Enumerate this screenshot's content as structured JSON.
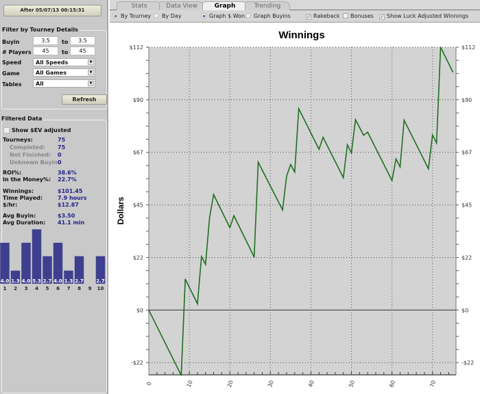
{
  "left": {
    "date_button": "After 05/07/13 00:15:31",
    "filter_title": "Filter by Tourney Details",
    "buyin_label": "Buyin",
    "buyin_from": "3.5",
    "buyin_to": "3.5",
    "players_label": "# Players",
    "players_from": "45",
    "players_to": "45",
    "to_label": "to",
    "speed_label": "Speed",
    "speed_value": "All Speeds",
    "game_label": "Game",
    "game_value": "All Games",
    "tables_label": "Tables",
    "tables_value": "All",
    "refresh": "Refresh",
    "filtered_title": "Filtered Data",
    "ev_label": "Show $EV adjusted",
    "stats": [
      {
        "label": "Tourneys:",
        "value": "75",
        "sub": false
      },
      {
        "label": "Completed:",
        "value": "75",
        "sub": true
      },
      {
        "label": "Not Finished:",
        "value": "0",
        "sub": true
      },
      {
        "label": "Unknown Buyin:",
        "value": "0",
        "sub": true
      },
      {
        "label": "ROI%:",
        "value": "38.6%",
        "sub": false
      },
      {
        "label": "In the Money%:",
        "value": "22.7%",
        "sub": false
      },
      {
        "label": "Winnings:",
        "value": "$101.45",
        "sub": false
      },
      {
        "label": "Time Played:",
        "value": "7.9 hours",
        "sub": false
      },
      {
        "label": "$/hr:",
        "value": "$12.87",
        "sub": false
      },
      {
        "label": "Avg Buyin:",
        "value": "$3.50",
        "sub": false
      },
      {
        "label": "Avg Duration:",
        "value": "41.1 min",
        "sub": false
      }
    ],
    "histogram": {
      "categories": [
        "1",
        "2",
        "3",
        "4",
        "5",
        "6",
        "7",
        "8",
        "9",
        "10"
      ],
      "values": [
        4.0,
        1.3,
        4.0,
        5.3,
        2.7,
        4.0,
        1.3,
        2.7,
        null,
        2.7
      ],
      "labels": [
        "4.0",
        "1.3",
        "4.0",
        "5.3",
        "2.7",
        "4.0",
        "1.3",
        "2.7",
        "",
        "2.7"
      ],
      "color": "#3f3f8f"
    }
  },
  "tabs": [
    {
      "label": "Stats",
      "active": false
    },
    {
      "label": "Data View",
      "active": false
    },
    {
      "label": "Graph",
      "active": true
    },
    {
      "label": "Trending",
      "active": false
    }
  ],
  "options": {
    "by_tourney": "By Tourney",
    "by_day": "By Day",
    "graph_won": "Graph $ Won",
    "graph_buyins": "Graph Buyins",
    "rakeback": "Rakeback",
    "bonuses": "Bonuses",
    "luck": "Show Luck Adjusted Winnings",
    "by_tourney_selected": true,
    "graph_won_selected": true,
    "rakeback_checked": true,
    "bonuses_checked": false,
    "luck_checked": true
  },
  "chart_data": {
    "type": "line",
    "title": "Winnings",
    "ylabel": "Dollars",
    "xlabel": "",
    "x_ticks": [
      "0",
      "10",
      "20",
      "30",
      "40",
      "50",
      "60",
      "70"
    ],
    "y_ticks": [
      "$112",
      "$90",
      "$67",
      "$45",
      "$22",
      "$0",
      "-$22"
    ],
    "y_tick_values": [
      112,
      89.6,
      67.2,
      44.8,
      22.4,
      0,
      -22.4
    ],
    "xlim": [
      0,
      75.8
    ],
    "ylim": [
      -27.6,
      112
    ],
    "grid": true,
    "line_color": "#1e6e1e",
    "background": "#d3d3d3",
    "x": [
      0,
      8,
      9,
      12,
      13,
      14,
      15,
      16,
      20,
      21,
      26,
      27,
      33,
      34,
      35,
      36,
      37,
      42,
      43,
      48,
      49,
      50,
      51,
      53,
      54,
      60,
      61,
      62,
      63,
      69,
      70,
      71,
      72,
      75
    ],
    "y": [
      0,
      -27.8,
      13.2,
      2.7,
      22.8,
      19.5,
      39.5,
      49.2,
      35.1,
      40.2,
      22.6,
      63,
      42.7,
      57.1,
      62,
      58.8,
      85.8,
      68.5,
      73.6,
      56.4,
      70.4,
      67,
      81.1,
      74.5,
      75.8,
      55.2,
      64.4,
      61,
      80.9,
      60.2,
      74.6,
      71.2,
      112,
      101.5
    ]
  }
}
